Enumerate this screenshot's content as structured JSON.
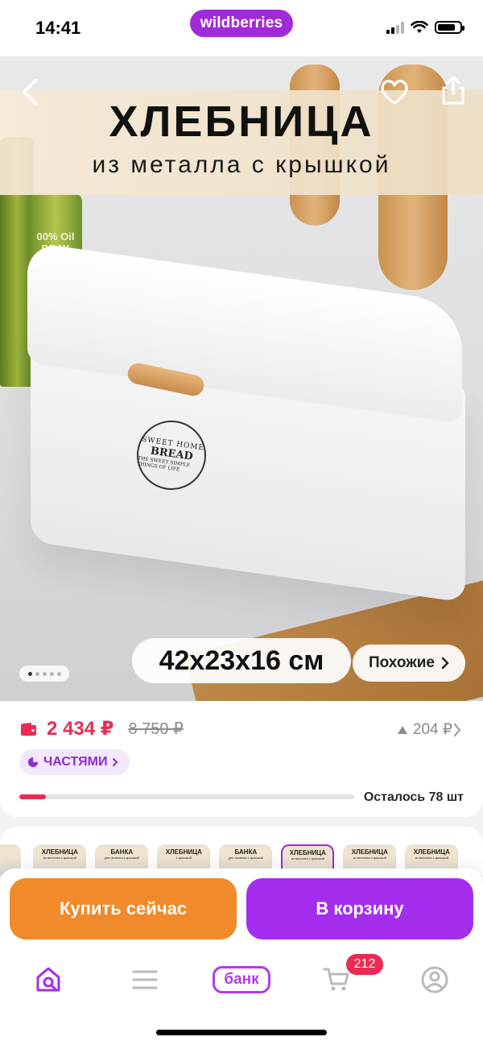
{
  "status_bar": {
    "time": "14:41",
    "brand": "wildberries"
  },
  "hero": {
    "title": "ХЛЕБНИЦА",
    "subtitle": "из металла с крышкой",
    "dimensions": "42x23x16 см",
    "similar_label": "Похожие",
    "emblem": {
      "top": "SWEET HOME",
      "main": "BREAD",
      "bottom": "THE SWEET SIMPLE THINGS OF LIFE"
    },
    "bottle_label": "00% Oil PRAY",
    "image_count": 5,
    "current_image": 1
  },
  "price": {
    "current": "2 434 ₽",
    "old": "8 750 ₽",
    "delta": "204 ₽",
    "installments_label": "ЧАСТЯМИ",
    "stock_label": "Осталось 78 шт",
    "stock_progress": 0.08
  },
  "variants": [
    {
      "title": "ХЛЕБНИЦА",
      "subtitle": "из металла с крышкой"
    },
    {
      "title": "БАНКА",
      "subtitle": "для печенья с крышкой"
    },
    {
      "title": "ХЛЕБНИЦА",
      "subtitle": "с крышкой"
    },
    {
      "title": "БАНКА",
      "subtitle": "для печенья с крышкой"
    },
    {
      "title": "ХЛЕБНИЦА",
      "subtitle": "из металла с крышкой"
    },
    {
      "title": "ХЛЕБНИЦА",
      "subtitle": "из металла с крышкой"
    },
    {
      "title": "ХЛЕБНИЦА",
      "subtitle": "из металла с крышкой"
    }
  ],
  "actions": {
    "buy_now": "Купить сейчас",
    "to_cart": "В корзину"
  },
  "tabbar": {
    "bank_label": "банк",
    "cart_badge": "212"
  },
  "colors": {
    "brand": "#a02bd8",
    "buy_now": "#f08a2a",
    "to_cart": "#a42dee",
    "price": "#ea2c54"
  }
}
